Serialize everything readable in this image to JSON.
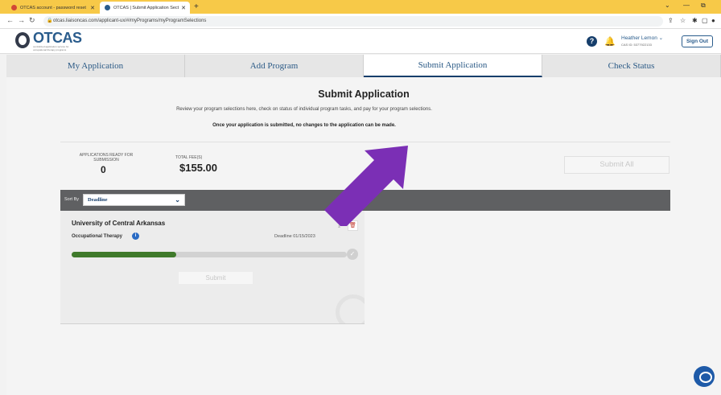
{
  "browser": {
    "tabs": [
      {
        "label": "OTCAS account - password reset",
        "icon_color": "#d14836"
      },
      {
        "label": "OTCAS | Submit Application Sect",
        "icon_color": "#2a5c8c"
      }
    ],
    "url": "otcas.liaisoncas.com/applicant-ux/#/myPrograms/myProgramSelections"
  },
  "header": {
    "logo": "OTCAS",
    "logo_tagline": "centralized application service for occupational therapy programs",
    "user_name": "Heather Lemon",
    "cas_id": "CAS ID: 5377922133",
    "sign_out": "Sign Out"
  },
  "nav_tabs": [
    {
      "label": "My Application",
      "active": false
    },
    {
      "label": "Add Program",
      "active": false
    },
    {
      "label": "Submit Application",
      "active": true
    },
    {
      "label": "Check Status",
      "active": false
    }
  ],
  "page": {
    "title": "Submit Application",
    "subtitle": "Review your program selections here, check on status of individual program tasks, and pay for your program selections.",
    "warning": "Once your application is submitted, no changes to the application can be made."
  },
  "summary": {
    "ready_label": "APPLICATIONS READY FOR SUBMISSION",
    "ready_count": "0",
    "fees_label": "TOTAL FEE(S)",
    "fees_value": "$155.00",
    "submit_all": "Submit All"
  },
  "sort": {
    "label": "Sort By",
    "selected": "Deadline"
  },
  "program_card": {
    "school": "University of Central Arkansas",
    "program": "Occupational Therapy",
    "deadline": "Deadline 01/15/2023",
    "progress": 0.38,
    "submit": "Submit"
  },
  "colors": {
    "brand": "#163e6b",
    "progress": "#3f7a2b",
    "arrow": "#7b2fb5",
    "browser_bar": "#f7c948"
  }
}
